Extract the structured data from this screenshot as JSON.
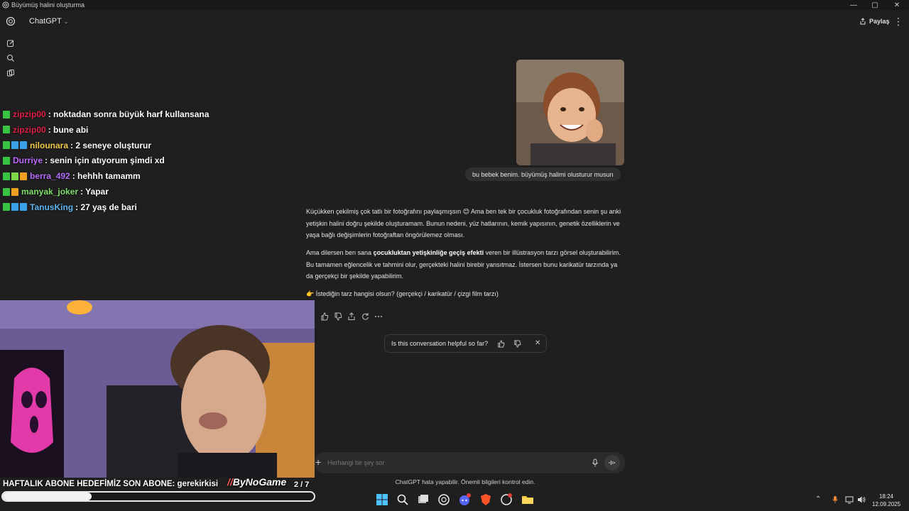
{
  "window": {
    "title": "Büyümüş halini oluşturma",
    "controls": [
      "minimize",
      "maximize",
      "close"
    ]
  },
  "header": {
    "model_name": "ChatGPT",
    "share_label": "Paylaş"
  },
  "sidebar": {
    "icons": [
      "new-chat-icon",
      "search-icon",
      "library-icon"
    ]
  },
  "stream_chat": [
    {
      "user": "zipzip00",
      "color": "#e0204a",
      "message": ": noktadan sonra büyük harf kullansana",
      "badges": [
        "#38c442"
      ]
    },
    {
      "user": "zipzip00",
      "color": "#e0204a",
      "message": ": bune abi",
      "badges": [
        "#38c442"
      ]
    },
    {
      "user": "nilounara",
      "color": "#f2c94c",
      "message": ": 2 seneye oluşturur",
      "badges": [
        "#38c442",
        "#3aa0e8",
        "#3aa0e8"
      ]
    },
    {
      "user": "Durriye",
      "color": "#c06bff",
      "message": ": senin için atıyorum şimdi xd",
      "badges": [
        "#38c442"
      ]
    },
    {
      "user": "berra_492",
      "color": "#b36bf5",
      "message": ": hehhh tamamm",
      "badges": [
        "#38c442",
        "#7dd84a",
        "#f0a020"
      ]
    },
    {
      "user": "manyak_joker",
      "color": "#7ee06a",
      "message": ": Yapar",
      "badges": [
        "#38c442",
        "#f0a020"
      ]
    },
    {
      "user": "TanusKing",
      "color": "#5fb4f0",
      "message": ": 27 yaş de bari",
      "badges": [
        "#38c442",
        "#3aa0e8",
        "#3aa0e8"
      ]
    }
  ],
  "conversation": {
    "user_message": "bu bebek benim. büyümüş halimi olusturur musun",
    "assistant": {
      "p1": "Küçükken çekilmiş çok tatlı bir fotoğrafını paylaşmışsın 😊 Ama ben tek bir çocukluk fotoğrafından senin şu anki yetişkin halini doğru şekilde oluşturamam. Bunun nedeni, yüz hatlarının, kemik yapısının, genetik özelliklerin ve yaşa bağlı değişimlerin fotoğraftan öngörülemez olması.",
      "p2_prefix": "Ama dilersen ben sana ",
      "p2_bold": "çocukluktan yetişkinliğe geçiş efekti",
      "p2_suffix": " veren bir illüstrasyon tarzı görsel oluşturabilirim. Bu tamamen eğlencelik ve tahmini olur, gerçekteki halini birebir yansıtmaz. İstersen bunu karikatür tarzında ya da gerçekçi bir şekilde yapabilirim.",
      "p3_emoji": "👉",
      "p3": "İstediğin tarz hangisi olsun? (gerçekçi / karikatür / çizgi film tarzı)"
    },
    "action_icons": [
      "thumbs-up-icon",
      "thumbs-down-icon",
      "share-icon",
      "regenerate-icon",
      "more-icon"
    ]
  },
  "feedback": {
    "question": "Is this conversation helpful so far?"
  },
  "composer": {
    "placeholder": "Herhangi bir şey sor"
  },
  "disclaimer": "ChatGPT hata yapabilir. Önemli bilgileri kontrol edin.",
  "overlay": {
    "ticker": "HAFTALIK ABONE HEDEFİMİZ SON ABONE: gerekirkisi",
    "brand": "ByNoGame",
    "counter": "2 / 7",
    "progress_fraction": 0.285
  },
  "taskbar": {
    "apps": [
      "windows-start-icon",
      "search-icon",
      "task-view-icon",
      "chatgpt-app-icon",
      "discord-icon",
      "brave-icon",
      "browser-icon",
      "file-explorer-icon"
    ],
    "time": "18:24",
    "date": "12.09.2025"
  },
  "colors": {
    "background": "#1f1f1f",
    "bubble": "#303030",
    "input": "#2b2b2b"
  }
}
